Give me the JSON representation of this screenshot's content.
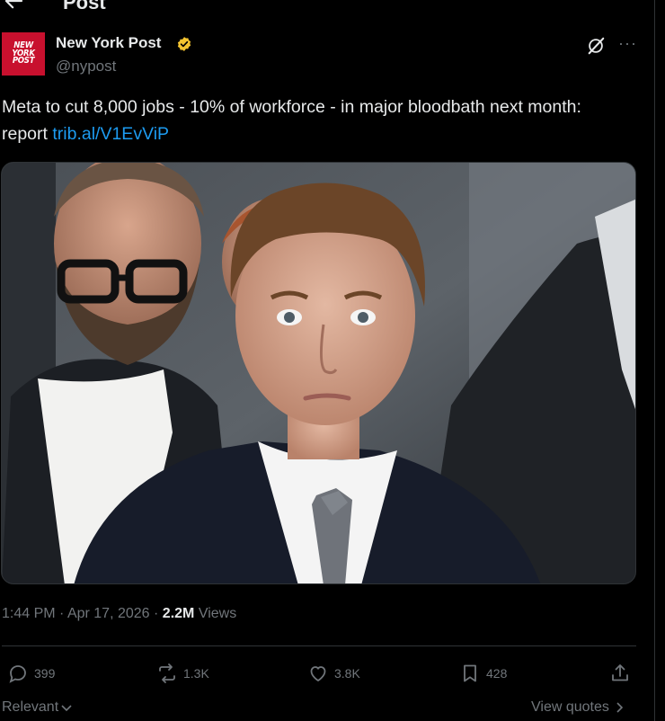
{
  "header": {
    "title": "Post"
  },
  "author": {
    "avatar_text": "NEW YORK POST",
    "display_name": "New York Post",
    "handle": "@nypost",
    "verified_color": "#f4c430",
    "avatar_color": "#c8102e"
  },
  "post": {
    "text": "Meta to cut 8,000 jobs - 10% of workforce - in major bloodbath next month: report ",
    "link": "trib.al/V1EvViP",
    "image_icon": "news-photo"
  },
  "meta": {
    "time": "1:44 PM",
    "date": "Apr 17, 2026",
    "views_count": "2.2M",
    "views_label": "Views"
  },
  "actions": {
    "replies": "399",
    "reposts": "1.3K",
    "likes": "3.8K",
    "bookmarks": "428"
  },
  "footer": {
    "sort_label": "Relevant",
    "quotes_label": "View quotes"
  },
  "colors": {
    "background": "#000000",
    "link": "#1d9bf0",
    "muted": "#71767b",
    "text": "#e7e9ea"
  }
}
